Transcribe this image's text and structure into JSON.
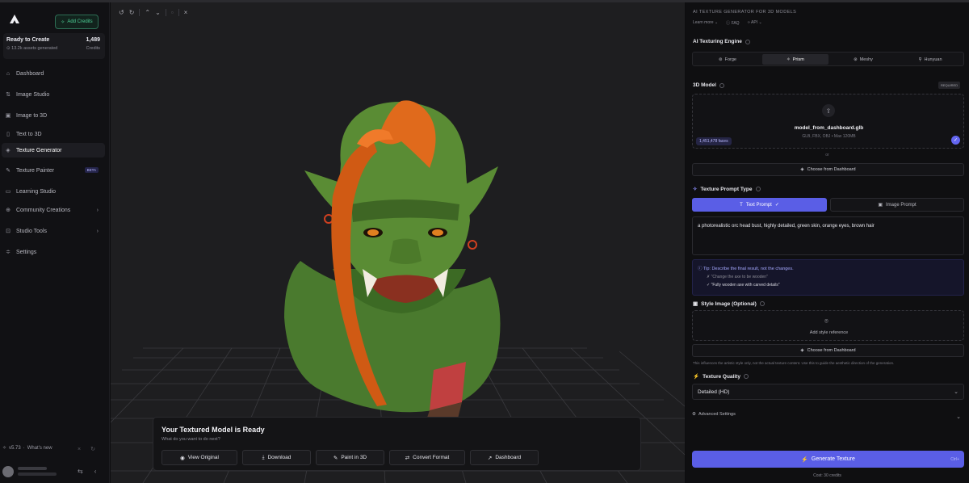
{
  "sidebar": {
    "add_credits": "Add Credits",
    "status": {
      "title": "Ready to Create",
      "assets": "13.2k assets generated",
      "credits_value": "1,489",
      "credits_label": "Credits"
    },
    "items": [
      {
        "label": "Dashboard",
        "icon": "home-icon"
      },
      {
        "label": "Image Studio",
        "icon": "image-studio-icon"
      },
      {
        "label": "Image to 3D",
        "icon": "image-icon"
      },
      {
        "label": "Text to 3D",
        "icon": "document-icon"
      },
      {
        "label": "Texture Generator",
        "icon": "layers-icon"
      },
      {
        "label": "Texture Painter",
        "icon": "brush-icon",
        "badge": "BETA"
      },
      {
        "label": "Learning Studio",
        "icon": "book-icon"
      },
      {
        "label": "Community Creations",
        "icon": "community-icon"
      },
      {
        "label": "Studio Tools",
        "icon": "tools-icon"
      },
      {
        "label": "Settings",
        "icon": "sliders-icon"
      }
    ],
    "version": "v5.73",
    "whats_new": "What's new"
  },
  "viewport": {
    "ready": {
      "title": "Your Textured Model is Ready",
      "subtitle": "What do you want to do next?",
      "actions": [
        "View Original",
        "Download",
        "Paint in 3D",
        "Convert Format",
        "Dashboard"
      ]
    }
  },
  "panel": {
    "title": "AI TEXTURE GENERATOR FOR 3D MODELS",
    "learn_more": "Learn more",
    "faq": "FAQ",
    "api": "API",
    "engine_label": "AI Texturing Engine",
    "engines": [
      "Forge",
      "Prism",
      "Meshy",
      "Hunyuan"
    ],
    "engine_selected": "Prism",
    "model_label": "3D Model",
    "required": "REQUIRED",
    "file_name": "model_from_dashboard.glb",
    "file_formats": "GLB, FBX, OBJ • Max 120MB",
    "faces": "1,451,478 faces",
    "or": "or",
    "choose_dashboard": "Choose from Dashboard",
    "prompt_type_label": "Texture Prompt Type",
    "text_prompt": "Text Prompt",
    "image_prompt": "Image Prompt",
    "prompt_text": "a photorealistic orc head bust, highly detailed, green skin, orange eyes, brown hair",
    "tip": "Tip: Describe the final result, not the changes.",
    "tip_bad": "\"Change the axe to be wooden\"",
    "tip_good": "\"Fully wooden axe with carved details\"",
    "style_label": "Style Image (Optional)",
    "add_style": "Add style reference",
    "choose_dashboard_2": "Choose from Dashboard",
    "style_note": "This influences the artistic style only, not the actual texture content. Use this to guide the aesthetic direction of the generation.",
    "quality_label": "Texture Quality",
    "quality_value": "Detailed (HD)",
    "advanced": "Advanced Settings",
    "generate": "Generate Texture",
    "generate_kbd": "Ctrl+",
    "cost": "Cost: 30 credits"
  },
  "colors": {
    "accent": "#5a5ee6",
    "green": "#4fd49a",
    "bg": "#0f0f11"
  }
}
